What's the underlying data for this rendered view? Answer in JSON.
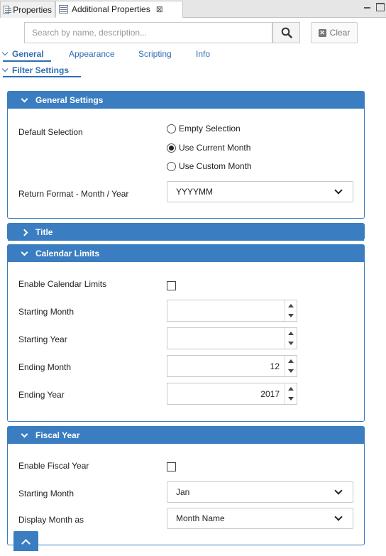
{
  "window": {
    "tabs": [
      {
        "label": "Properties"
      },
      {
        "label": "Additional Properties",
        "close": "⊠"
      }
    ]
  },
  "search": {
    "placeholder": "Search by name, description...",
    "value": "",
    "clear_label": "Clear"
  },
  "nav": {
    "tabs": [
      {
        "label": "General"
      },
      {
        "label": "Appearance"
      },
      {
        "label": "Scripting"
      },
      {
        "label": "Info"
      }
    ],
    "sub": "Filter Settings"
  },
  "general_settings": {
    "title": "General Settings",
    "default_selection_label": "Default Selection",
    "options": [
      "Empty Selection",
      "Use Current Month",
      "Use Custom Month"
    ],
    "selected_option": "Use Current Month",
    "return_format_label": "Return Format - Month / Year",
    "return_format_value": "YYYYMM"
  },
  "title_panel": {
    "title": "Title"
  },
  "calendar_limits": {
    "title": "Calendar Limits",
    "enable_label": "Enable Calendar Limits",
    "enabled": false,
    "starting_month_label": "Starting Month",
    "starting_month_value": "",
    "starting_year_label": "Starting Year",
    "starting_year_value": "",
    "ending_month_label": "Ending Month",
    "ending_month_value": "12",
    "ending_year_label": "Ending Year",
    "ending_year_value": "2017"
  },
  "fiscal_year": {
    "title": "Fiscal Year",
    "enable_label": "Enable Fiscal Year",
    "enabled": false,
    "starting_month_label": "Starting Month",
    "starting_month_value": "Jan",
    "display_month_label": "Display Month as",
    "display_month_value": "Month Name"
  },
  "colors": {
    "accent": "#3a7dc0",
    "link": "#2f6db3"
  }
}
